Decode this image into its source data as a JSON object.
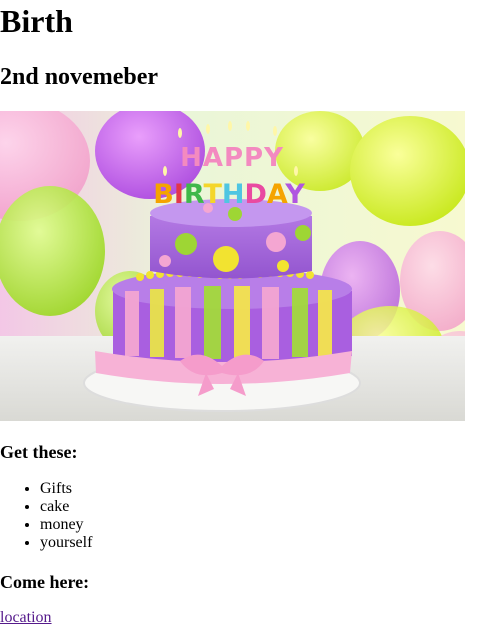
{
  "heading": {
    "title": "Birth",
    "date": "2nd novemeber"
  },
  "image": {
    "icon": "birthday-cake-image",
    "cake_text": "HAPPY BIRTHDAY",
    "alt": ""
  },
  "get_these": {
    "title": "Get these:",
    "items": [
      "Gifts",
      "cake",
      "money",
      "yourself"
    ]
  },
  "come_here": {
    "title": "Come here:",
    "link_label": "location"
  },
  "colors": {
    "link_visited": "#551a8b"
  }
}
